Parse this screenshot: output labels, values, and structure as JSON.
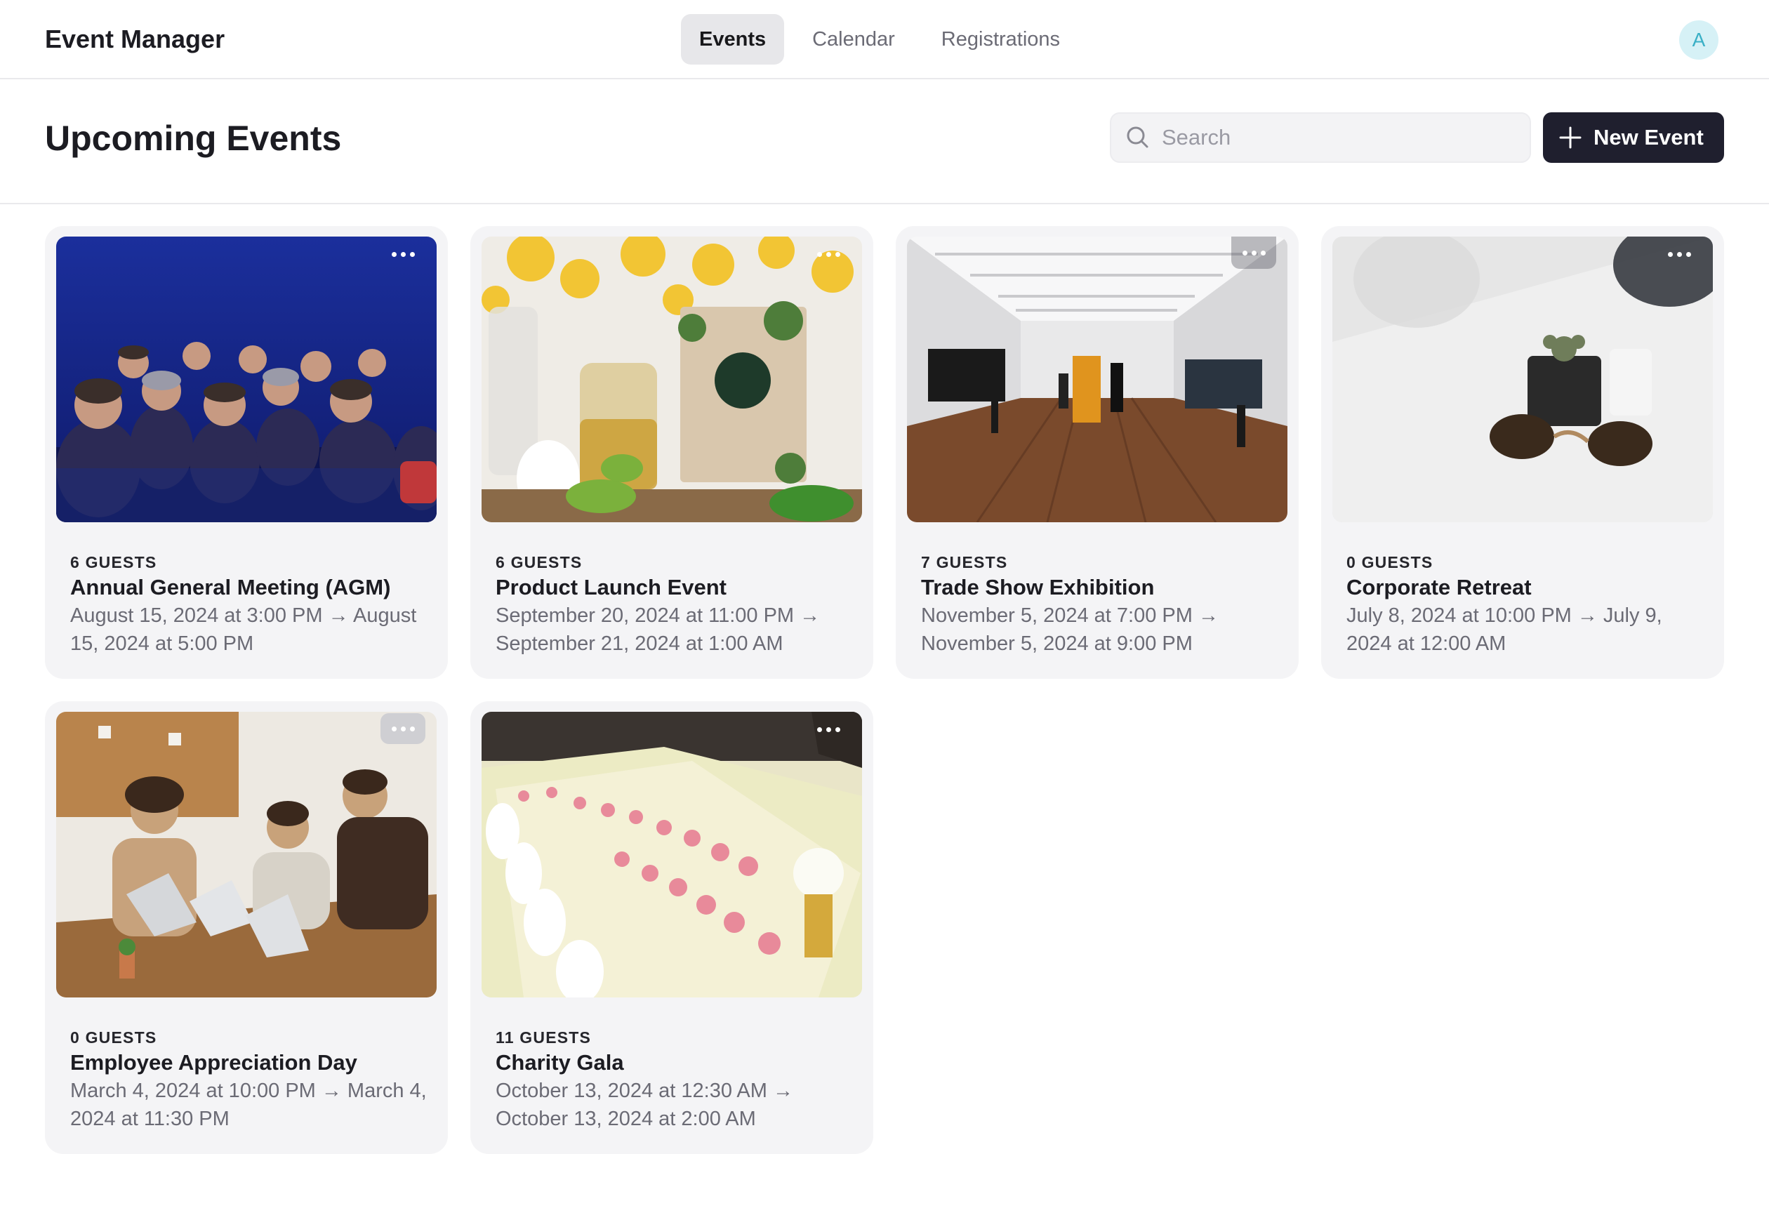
{
  "app": {
    "title": "Event Manager",
    "nav_tabs": [
      {
        "label": "Events",
        "active": true
      },
      {
        "label": "Calendar",
        "active": false
      },
      {
        "label": "Registrations",
        "active": false
      }
    ],
    "avatar_initial": "A"
  },
  "header": {
    "page_title": "Upcoming Events",
    "search_placeholder": "Search",
    "new_event_label": "New Event"
  },
  "events": [
    {
      "guests": "6 GUESTS",
      "title": "Annual General Meeting (AGM)",
      "dates": "August 15, 2024 at 3:00 PM → August 15, 2024 at 5:00 PM",
      "image": "audience-photo"
    },
    {
      "guests": "6 GUESTS",
      "title": "Product Launch Event",
      "dates": "September 20, 2024 at 11:00 PM → September 21, 2024 at 1:00 AM",
      "image": "soap-product-photo"
    },
    {
      "guests": "7 GUESTS",
      "title": "Trade Show Exhibition",
      "dates": "November 5, 2024 at 7:00 PM → November 5, 2024 at 9:00 PM",
      "image": "gallery-hall-photo"
    },
    {
      "guests": "0 GUESTS",
      "title": "Corporate Retreat",
      "dates": "July 8, 2024 at 10:00 PM → July 9, 2024 at 12:00 AM",
      "image": "sunglasses-desk-photo"
    },
    {
      "guests": "0 GUESTS",
      "title": "Employee Appreciation Day",
      "dates": "March 4, 2024 at 10:00 PM → March 4, 2024 at 11:30 PM",
      "image": "office-meeting-photo"
    },
    {
      "guests": "11 GUESTS",
      "title": "Charity Gala",
      "dates": "October 13, 2024 at 12:30 AM → October 13, 2024 at 2:00 AM",
      "image": "banquet-table-photo"
    }
  ],
  "colors": {
    "primary_button": "#1f1f2e",
    "avatar_bg": "#d6f1f6",
    "avatar_text": "#3ab0c6",
    "card_bg": "#f4f4f6"
  }
}
